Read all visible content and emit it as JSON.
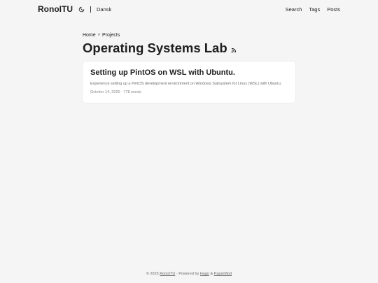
{
  "header": {
    "logo": "RonoITU",
    "theme_toggle_icon": "moon-icon",
    "language": "Dansk",
    "nav": [
      {
        "label": "Search"
      },
      {
        "label": "Tags"
      },
      {
        "label": "Posts"
      }
    ]
  },
  "breadcrumbs": {
    "home": "Home",
    "separator": "»",
    "current": "Projects"
  },
  "page": {
    "title": "Operating Systems Lab",
    "rss_icon": "rss-icon"
  },
  "posts": [
    {
      "title": "Setting up PintOS on WSL with Ubuntu.",
      "summary": "Experience setting up a PintOS development environment on Windows Subsystem for Linux (WSL) with Ubuntu.",
      "meta": "October 14, 2025 · 778 words"
    }
  ],
  "footer": {
    "copyright": "© 2025",
    "site_link": "RonoITU",
    "separator": "·",
    "powered_by": "Powered by",
    "hugo": "Hugo",
    "amp": "&",
    "papermod": "PaperMod"
  },
  "colors": {
    "background": "#f5f5f5",
    "card": "#ffffff",
    "text": "#1e1e1e",
    "muted": "#6b6b6b"
  }
}
